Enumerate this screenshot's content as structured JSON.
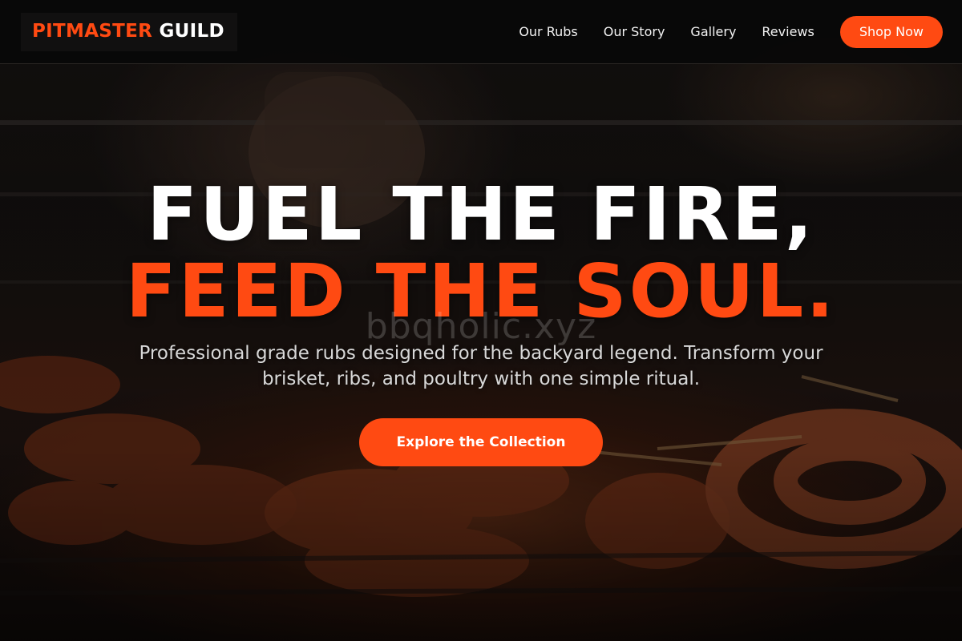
{
  "header": {
    "logo_part1": "PITMASTER",
    "logo_part2": "GUILD",
    "nav": [
      "Our Rubs",
      "Our Story",
      "Gallery",
      "Reviews"
    ],
    "shop_label": "Shop Now"
  },
  "hero": {
    "headline_line1": "FUEL THE FIRE,",
    "headline_line2": "FEED THE SOUL.",
    "watermark": "bbqholic.xyz",
    "subtitle": "Professional grade rubs designed for the backyard legend. Transform your brisket, ribs, and poultry with one simple ritual.",
    "cta_label": "Explore the Collection",
    "background_icon": "grill-meat-photo"
  },
  "colors": {
    "accent": "#ff4a12",
    "header_bg": "#080808",
    "text_primary": "#ffffff",
    "text_secondary": "#d8d8d8"
  }
}
